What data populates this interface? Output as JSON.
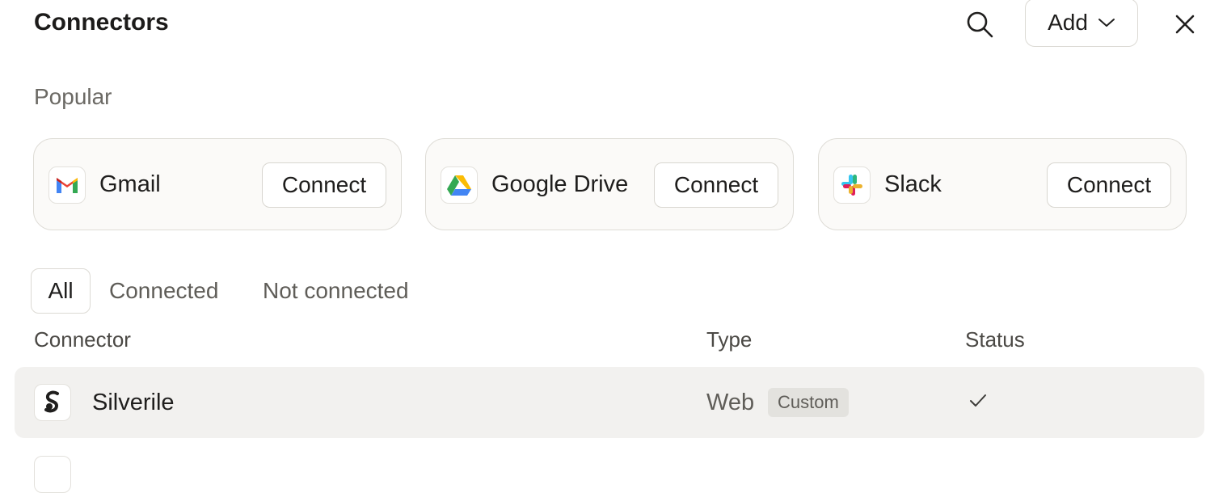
{
  "header": {
    "title": "Connectors",
    "add_label": "Add",
    "search_icon": "search-icon",
    "close_icon": "close-icon"
  },
  "popular": {
    "label": "Popular",
    "cards": [
      {
        "name": "Gmail",
        "icon": "gmail-icon",
        "action": "Connect"
      },
      {
        "name": "Google Drive",
        "icon": "google-drive-icon",
        "action": "Connect"
      },
      {
        "name": "Slack",
        "icon": "slack-icon",
        "action": "Connect"
      }
    ]
  },
  "filters": {
    "tabs": [
      "All",
      "Connected",
      "Not connected"
    ],
    "active": "All"
  },
  "table": {
    "columns": [
      "Connector",
      "Type",
      "Status"
    ],
    "rows": [
      {
        "name": "Silverile",
        "type": "Web",
        "badge": "Custom",
        "status": "check-icon"
      }
    ]
  },
  "colors": {
    "card_bg": "#fbfaf8",
    "row_bg": "#f2f1ef",
    "badge_bg": "#e3e2de",
    "gmail_red": "#ea4335",
    "drive_green": "#34a853",
    "drive_yellow": "#fbbc04",
    "drive_blue": "#4285f4",
    "slack_purple": "#e01e5a"
  }
}
